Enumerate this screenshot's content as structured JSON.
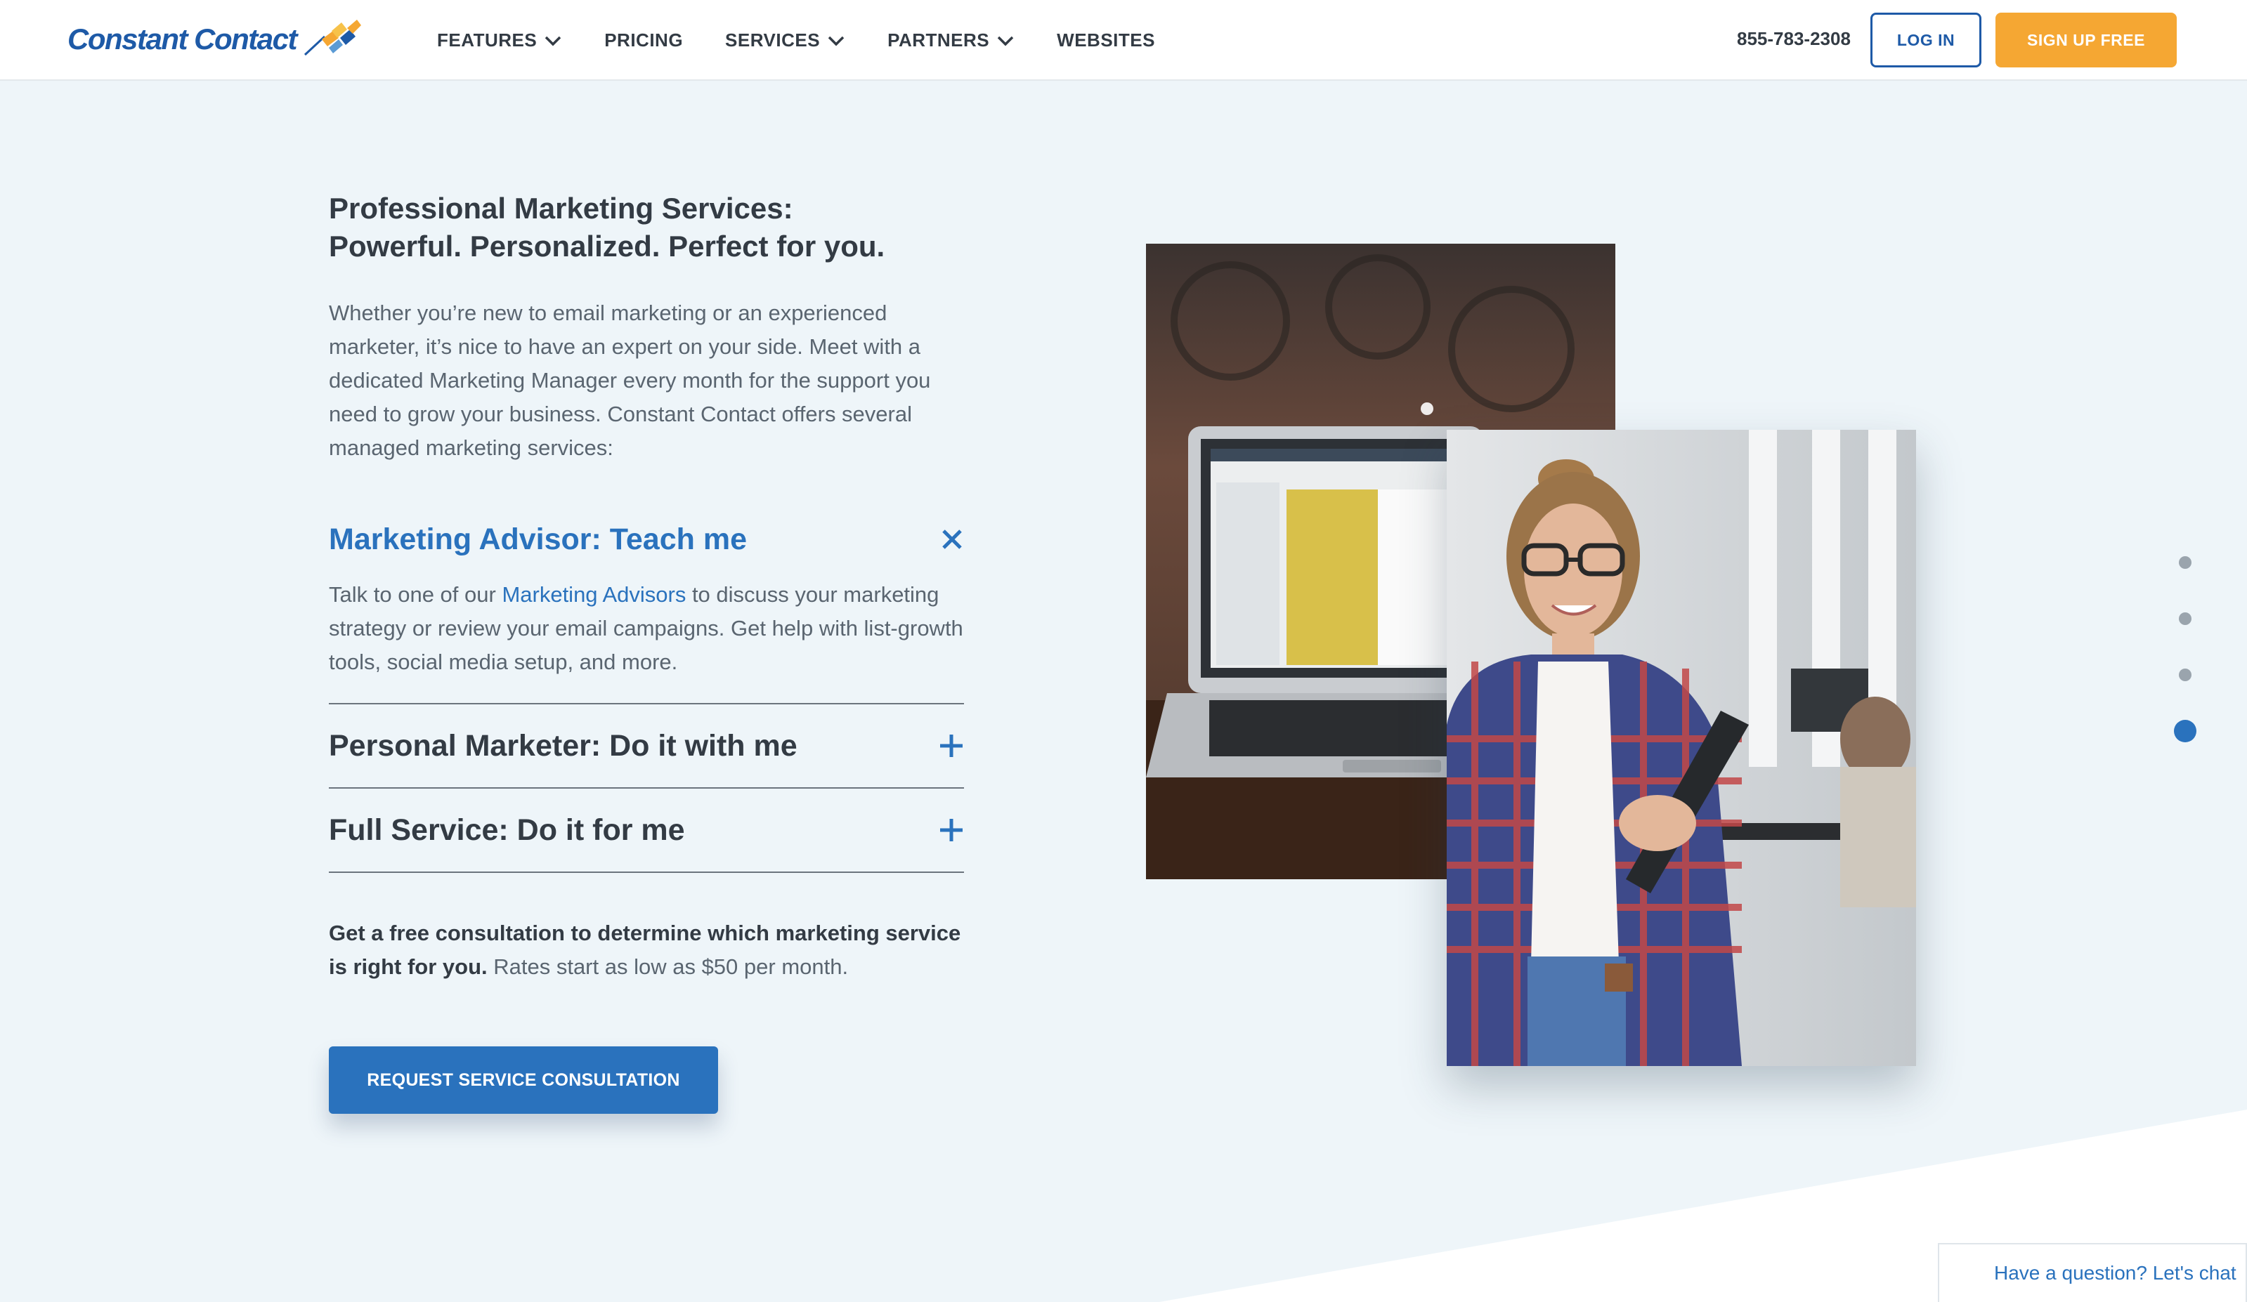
{
  "brand": {
    "name": "Constant Contact",
    "colors": {
      "primary": "#2a72bd",
      "accent": "#f5a733",
      "text": "#333b44",
      "background": "#eef5f9"
    }
  },
  "nav": {
    "items": [
      {
        "label": "FEATURES",
        "has_dropdown": true
      },
      {
        "label": "PRICING",
        "has_dropdown": false
      },
      {
        "label": "SERVICES",
        "has_dropdown": true
      },
      {
        "label": "PARTNERS",
        "has_dropdown": true
      },
      {
        "label": "WEBSITES",
        "has_dropdown": false
      }
    ],
    "phone": "855-783-2308",
    "login_label": "LOG IN",
    "signup_label": "SIGN UP FREE"
  },
  "main": {
    "headline_line1": "Professional Marketing Services:",
    "headline_line2": "Powerful. Personalized. Perfect for you.",
    "intro": "Whether you’re new to email marketing or an experienced marketer, it’s nice to have an expert on your side. Meet with a dedicated Marketing Manager every month for the support you need to grow your business. Constant Contact offers several managed marketing services:",
    "accordion": [
      {
        "title": "Marketing Advisor: Teach me",
        "expanded": true,
        "body_before_link": "Talk to one of our ",
        "body_link": "Marketing Advisors",
        "body_after_link": " to discuss your marketing strategy or review your email campaigns. Get help with list-growth tools, social media setup, and more.",
        "icon": "close-icon"
      },
      {
        "title": "Personal Marketer: Do it with me",
        "expanded": false,
        "icon": "plus-icon"
      },
      {
        "title": "Full Service: Do it for me",
        "expanded": false,
        "icon": "plus-icon"
      }
    ],
    "consult_bold": "Get a free consultation to determine which marketing service is right for you.",
    "consult_rest": " Rates start as low as $50 per month.",
    "cta_label": "REQUEST SERVICE CONSULTATION"
  },
  "section_dots": {
    "count": 4,
    "active_index": 3
  },
  "chat": {
    "label": "Have a question? Let's chat"
  }
}
